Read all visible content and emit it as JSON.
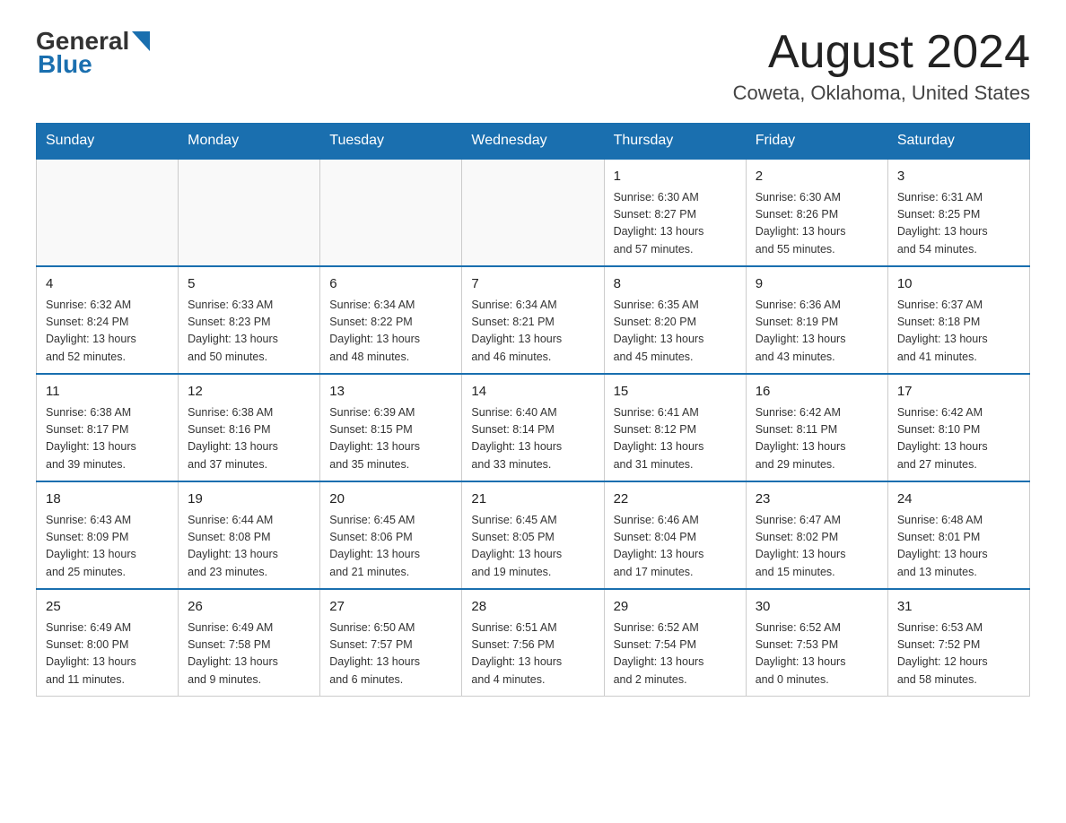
{
  "header": {
    "logo_general": "General",
    "logo_blue": "Blue",
    "month_title": "August 2024",
    "location": "Coweta, Oklahoma, United States"
  },
  "days_of_week": [
    "Sunday",
    "Monday",
    "Tuesday",
    "Wednesday",
    "Thursday",
    "Friday",
    "Saturday"
  ],
  "weeks": [
    [
      {
        "day": "",
        "info": ""
      },
      {
        "day": "",
        "info": ""
      },
      {
        "day": "",
        "info": ""
      },
      {
        "day": "",
        "info": ""
      },
      {
        "day": "1",
        "info": "Sunrise: 6:30 AM\nSunset: 8:27 PM\nDaylight: 13 hours\nand 57 minutes."
      },
      {
        "day": "2",
        "info": "Sunrise: 6:30 AM\nSunset: 8:26 PM\nDaylight: 13 hours\nand 55 minutes."
      },
      {
        "day": "3",
        "info": "Sunrise: 6:31 AM\nSunset: 8:25 PM\nDaylight: 13 hours\nand 54 minutes."
      }
    ],
    [
      {
        "day": "4",
        "info": "Sunrise: 6:32 AM\nSunset: 8:24 PM\nDaylight: 13 hours\nand 52 minutes."
      },
      {
        "day": "5",
        "info": "Sunrise: 6:33 AM\nSunset: 8:23 PM\nDaylight: 13 hours\nand 50 minutes."
      },
      {
        "day": "6",
        "info": "Sunrise: 6:34 AM\nSunset: 8:22 PM\nDaylight: 13 hours\nand 48 minutes."
      },
      {
        "day": "7",
        "info": "Sunrise: 6:34 AM\nSunset: 8:21 PM\nDaylight: 13 hours\nand 46 minutes."
      },
      {
        "day": "8",
        "info": "Sunrise: 6:35 AM\nSunset: 8:20 PM\nDaylight: 13 hours\nand 45 minutes."
      },
      {
        "day": "9",
        "info": "Sunrise: 6:36 AM\nSunset: 8:19 PM\nDaylight: 13 hours\nand 43 minutes."
      },
      {
        "day": "10",
        "info": "Sunrise: 6:37 AM\nSunset: 8:18 PM\nDaylight: 13 hours\nand 41 minutes."
      }
    ],
    [
      {
        "day": "11",
        "info": "Sunrise: 6:38 AM\nSunset: 8:17 PM\nDaylight: 13 hours\nand 39 minutes."
      },
      {
        "day": "12",
        "info": "Sunrise: 6:38 AM\nSunset: 8:16 PM\nDaylight: 13 hours\nand 37 minutes."
      },
      {
        "day": "13",
        "info": "Sunrise: 6:39 AM\nSunset: 8:15 PM\nDaylight: 13 hours\nand 35 minutes."
      },
      {
        "day": "14",
        "info": "Sunrise: 6:40 AM\nSunset: 8:14 PM\nDaylight: 13 hours\nand 33 minutes."
      },
      {
        "day": "15",
        "info": "Sunrise: 6:41 AM\nSunset: 8:12 PM\nDaylight: 13 hours\nand 31 minutes."
      },
      {
        "day": "16",
        "info": "Sunrise: 6:42 AM\nSunset: 8:11 PM\nDaylight: 13 hours\nand 29 minutes."
      },
      {
        "day": "17",
        "info": "Sunrise: 6:42 AM\nSunset: 8:10 PM\nDaylight: 13 hours\nand 27 minutes."
      }
    ],
    [
      {
        "day": "18",
        "info": "Sunrise: 6:43 AM\nSunset: 8:09 PM\nDaylight: 13 hours\nand 25 minutes."
      },
      {
        "day": "19",
        "info": "Sunrise: 6:44 AM\nSunset: 8:08 PM\nDaylight: 13 hours\nand 23 minutes."
      },
      {
        "day": "20",
        "info": "Sunrise: 6:45 AM\nSunset: 8:06 PM\nDaylight: 13 hours\nand 21 minutes."
      },
      {
        "day": "21",
        "info": "Sunrise: 6:45 AM\nSunset: 8:05 PM\nDaylight: 13 hours\nand 19 minutes."
      },
      {
        "day": "22",
        "info": "Sunrise: 6:46 AM\nSunset: 8:04 PM\nDaylight: 13 hours\nand 17 minutes."
      },
      {
        "day": "23",
        "info": "Sunrise: 6:47 AM\nSunset: 8:02 PM\nDaylight: 13 hours\nand 15 minutes."
      },
      {
        "day": "24",
        "info": "Sunrise: 6:48 AM\nSunset: 8:01 PM\nDaylight: 13 hours\nand 13 minutes."
      }
    ],
    [
      {
        "day": "25",
        "info": "Sunrise: 6:49 AM\nSunset: 8:00 PM\nDaylight: 13 hours\nand 11 minutes."
      },
      {
        "day": "26",
        "info": "Sunrise: 6:49 AM\nSunset: 7:58 PM\nDaylight: 13 hours\nand 9 minutes."
      },
      {
        "day": "27",
        "info": "Sunrise: 6:50 AM\nSunset: 7:57 PM\nDaylight: 13 hours\nand 6 minutes."
      },
      {
        "day": "28",
        "info": "Sunrise: 6:51 AM\nSunset: 7:56 PM\nDaylight: 13 hours\nand 4 minutes."
      },
      {
        "day": "29",
        "info": "Sunrise: 6:52 AM\nSunset: 7:54 PM\nDaylight: 13 hours\nand 2 minutes."
      },
      {
        "day": "30",
        "info": "Sunrise: 6:52 AM\nSunset: 7:53 PM\nDaylight: 13 hours\nand 0 minutes."
      },
      {
        "day": "31",
        "info": "Sunrise: 6:53 AM\nSunset: 7:52 PM\nDaylight: 12 hours\nand 58 minutes."
      }
    ]
  ]
}
